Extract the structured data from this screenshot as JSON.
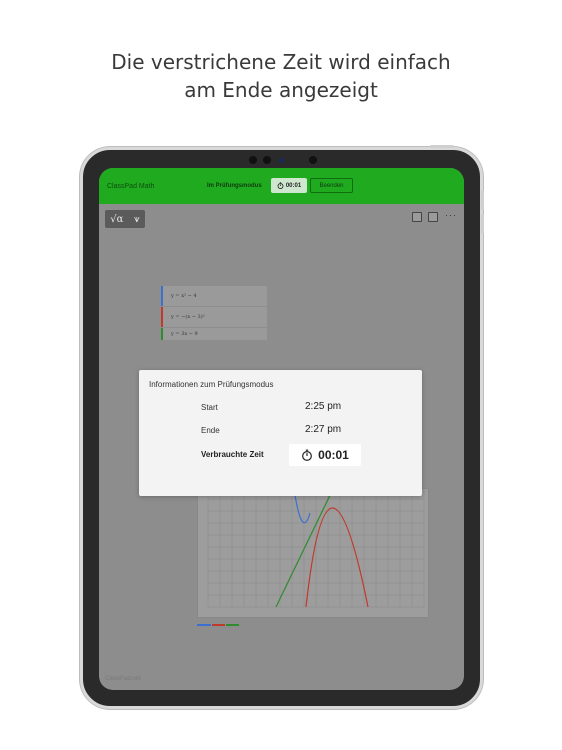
{
  "headline": {
    "line1": "Die verstrichene Zeit wird einfach",
    "line2": "am Ende angezeigt"
  },
  "app": {
    "title": "ClassPad Math",
    "exam_label": "Im Prüfungsmodus",
    "timer": "00:01",
    "end_button": "Beenden",
    "watermark": "ClassPad.net"
  },
  "toolbar": {
    "tool1": "√α",
    "tool2": "⩛"
  },
  "expressions": [
    {
      "text": "y = x² − 4"
    },
    {
      "text": "y = −(x − 3)²"
    },
    {
      "text": "y = 3x − 9"
    }
  ],
  "modal": {
    "title": "Informationen zum Prüfungsmodus",
    "start_label": "Start",
    "start_value": "2:25 pm",
    "end_label": "Ende",
    "end_value": "2:27 pm",
    "elapsed_label": "Verbrauchte Zeit",
    "elapsed_value": "00:01"
  },
  "colors": {
    "topbar": "#1faa1f",
    "blue": "#3b6fd1",
    "red": "#c0392b",
    "green": "#2e8b2e"
  }
}
